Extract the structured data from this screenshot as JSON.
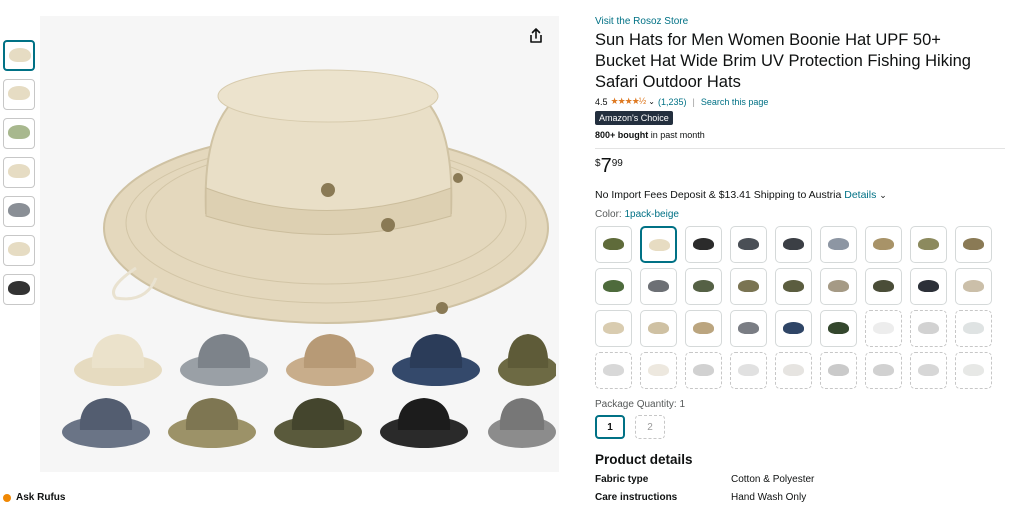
{
  "store": {
    "link": "Visit the Rosoz Store"
  },
  "product": {
    "title": "Sun Hats for Men Women Boonie Hat UPF 50+ Bucket Hat Wide Brim UV Protection Fishing Hiking Safari Outdoor Hats",
    "rating_value": "4.5",
    "stars": "★★★★½",
    "rating_count": "(1,235)",
    "search_page": "Search this page",
    "badge": "Amazon's Choice",
    "bought_bold": "800+ bought",
    "bought_rest": " in past month",
    "price_currency": "$",
    "price_whole": "7",
    "price_fraction": "99",
    "shipping_text": "No Import Fees Deposit & $13.41 Shipping to Austria ",
    "shipping_details": "Details",
    "color_label": "Color: ",
    "color_value": "1pack-beige",
    "package_label": "Package Quantity: 1",
    "package_options": [
      "1",
      "2"
    ]
  },
  "swatch_colors": [
    "#5f6b3a",
    "#e7dcc2",
    "#2b2b2b",
    "#4a4f56",
    "#3b3f45",
    "#8d96a3",
    "#a89368",
    "#8c8a5e",
    "#8a7a55",
    "#4e6b3c",
    "#6d7075",
    "#556145",
    "#7a7452",
    "#5b5d3f",
    "#a59a85",
    "#4a4d38",
    "#2c3038",
    "#cbbfa9",
    "#d9ccb0",
    "#cfc1a3",
    "#bba57f",
    "#7a7d84",
    "#2f4566",
    "#34472d",
    "#d8d8d8",
    "#9b9b9b",
    "#b9c0c0",
    "#a8a8a8",
    "#d6cdb9",
    "#9a9a9a",
    "#bcbcbc",
    "#c8c4bc",
    "#8a8a8a",
    "#9a9a9a",
    "#a7a7a7",
    "#c9cdc7"
  ],
  "details": {
    "heading": "Product details",
    "rows": [
      {
        "key": "Fabric type",
        "value": "Cotton & Polyester"
      },
      {
        "key": "Care instructions",
        "value": "Hand Wash Only"
      }
    ]
  },
  "gallery": {
    "ask_rufus": "Ask Rufus"
  }
}
